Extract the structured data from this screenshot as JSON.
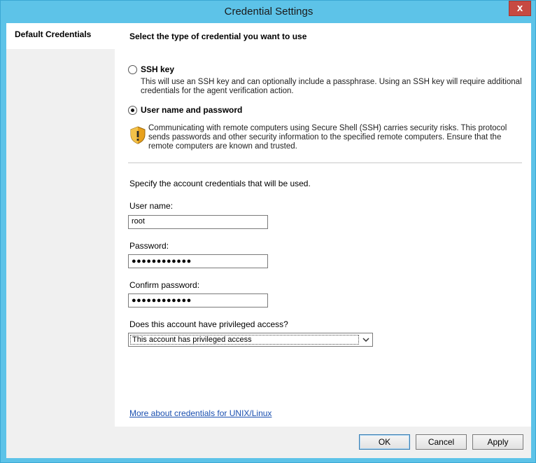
{
  "window": {
    "title": "Credential Settings",
    "close_glyph": "x"
  },
  "nav": {
    "items": [
      {
        "label": "Default Credentials"
      }
    ]
  },
  "content": {
    "heading": "Select the type of credential you want to use",
    "options": [
      {
        "label": "SSH key",
        "checked": false,
        "description": "This will use an SSH key and can optionally include a passphrase. Using an SSH key will require additional credentials for the agent verification action."
      },
      {
        "label": "User name and password",
        "checked": true
      }
    ],
    "warning": {
      "icon": "shield-warning-icon",
      "text": "Communicating with remote computers using Secure Shell (SSH) carries security risks. This protocol sends passwords and other security information to the specified remote computers. Ensure that the remote computers are known and trusted."
    },
    "instructions": "Specify the account credentials that will be used.",
    "fields": {
      "username": {
        "label": "User name:",
        "value": "root"
      },
      "password": {
        "label": "Password:",
        "value": "●●●●●●●●●●●●"
      },
      "confirm": {
        "label": "Confirm password:",
        "value": "●●●●●●●●●●●●"
      }
    },
    "privileged": {
      "label": "Does this account have privileged access?",
      "selected": "This account has privileged access"
    },
    "help_link": "More about credentials for UNIX/Linux"
  },
  "footer": {
    "ok_label": "OK",
    "cancel_label": "Cancel",
    "apply_label": "Apply"
  },
  "colors": {
    "frame": "#5dc3e8",
    "close": "#c74a42",
    "link": "#1a4fb0"
  }
}
